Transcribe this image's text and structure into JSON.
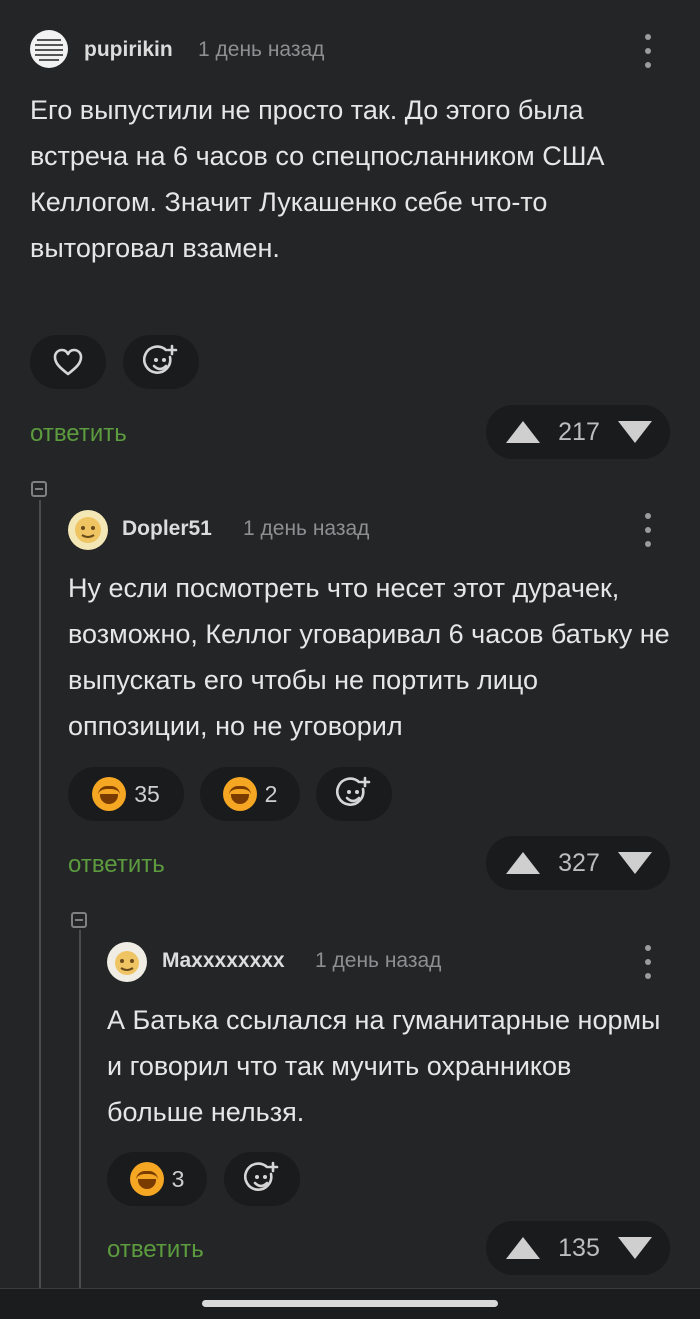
{
  "comments": [
    {
      "author": "pupirikin",
      "time": "1 день назад",
      "text": "Его выпустили не просто так. До этого была встреча на 6 часов со спецпосланником США Келлогом. Значит Лукашенко себе что-то выторговал взамен.",
      "reactions": [],
      "reply_label": "ответить",
      "score": "217"
    },
    {
      "author": "Dopler51",
      "time": "1 день назад",
      "text": "Ну если посмотреть что несет этот дурачек, возможно, Келлог уговаривал 6 часов батьку не выпускать его чтобы не портить лицо оппозиции, но не уговорил",
      "reactions": [
        {
          "icon": "laugh-tears-emoji-icon",
          "count": "35"
        },
        {
          "icon": "grin-emoji-icon",
          "count": "2"
        }
      ],
      "reply_label": "ответить",
      "score": "327"
    },
    {
      "author": "Maxxxxxxxx",
      "time": "1 день назад",
      "text": "А Батька ссылался на гуманитарные нормы и говорил что так мучить охранников больше нельзя.",
      "reactions": [
        {
          "icon": "grin-emoji-icon",
          "count": "3"
        }
      ],
      "reply_label": "ответить",
      "score": "135"
    }
  ],
  "colors": {
    "background": "#232527",
    "pill": "#1a1b1d",
    "reply_link": "#5c9b3e",
    "emoji": "#f5a623"
  }
}
